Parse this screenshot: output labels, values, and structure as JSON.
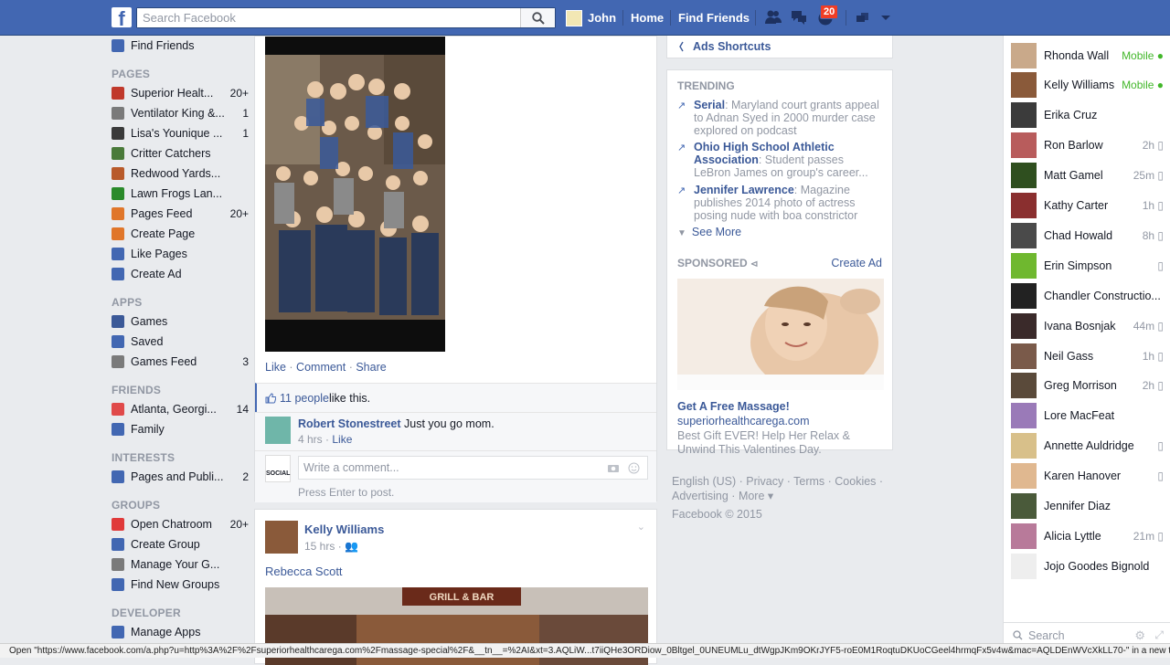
{
  "topbar": {
    "logo": "f",
    "search_placeholder": "Search Facebook",
    "user_name": "John",
    "home": "Home",
    "find_friends": "Find Friends",
    "notifications_count": "20"
  },
  "left_nav": {
    "top_items": [
      {
        "label": "Find Friends"
      }
    ],
    "pages_heading": "PAGES",
    "pages": [
      {
        "label": "Superior Healt...",
        "count": "20+"
      },
      {
        "label": "Ventilator King &...",
        "count": "1"
      },
      {
        "label": "Lisa's Younique ...",
        "count": "1"
      },
      {
        "label": "Critter Catchers",
        "count": ""
      },
      {
        "label": "Redwood Yards...",
        "count": ""
      },
      {
        "label": "Lawn Frogs Lan...",
        "count": ""
      },
      {
        "label": "Pages Feed",
        "count": "20+"
      },
      {
        "label": "Create Page",
        "count": ""
      },
      {
        "label": "Like Pages",
        "count": ""
      },
      {
        "label": "Create Ad",
        "count": ""
      }
    ],
    "apps_heading": "APPS",
    "apps": [
      {
        "label": "Games",
        "count": ""
      },
      {
        "label": "Saved",
        "count": ""
      },
      {
        "label": "Games Feed",
        "count": "3"
      }
    ],
    "friends_heading": "FRIENDS",
    "friends": [
      {
        "label": "Atlanta, Georgi...",
        "count": "14"
      },
      {
        "label": "Family",
        "count": ""
      }
    ],
    "interests_heading": "INTERESTS",
    "interests": [
      {
        "label": "Pages and Publi...",
        "count": "2"
      }
    ],
    "groups_heading": "GROUPS",
    "groups": [
      {
        "label": "Open Chatroom",
        "count": "20+"
      },
      {
        "label": "Create Group",
        "count": ""
      },
      {
        "label": "Manage Your G...",
        "count": ""
      },
      {
        "label": "Find New Groups",
        "count": ""
      }
    ],
    "developer_heading": "DEVELOPER",
    "developer": [
      {
        "label": "Manage Apps",
        "count": ""
      }
    ]
  },
  "post1": {
    "actions": {
      "like": "Like",
      "comment": "Comment",
      "share": "Share"
    },
    "likes_count": "11 people",
    "likes_suffix": " like this.",
    "comment": {
      "author": "Robert Stonestreet",
      "text": "Just you go mom.",
      "time": "4 hrs",
      "like": "Like"
    },
    "write_placeholder": "Write a comment...",
    "write_hint": "Press Enter to post.",
    "avatar_text": "SOCIAL"
  },
  "post2": {
    "author": "Kelly Williams",
    "time": "15 hrs",
    "tagged": "Rebecca Scott",
    "sign_text": "GRILL & BAR"
  },
  "right": {
    "ads_shortcuts": "Ads Shortcuts",
    "trending_heading": "TRENDING",
    "trending": [
      {
        "topic": "Serial",
        "text": ": Maryland court grants appeal to Adnan Syed in 2000 murder case explored on podcast"
      },
      {
        "topic": "Ohio High School Athletic Association",
        "text": ": Student passes LeBron James on group's career..."
      },
      {
        "topic": "Jennifer Lawrence",
        "text": ": Magazine publishes 2014 photo of actress posing nude with boa constrictor"
      }
    ],
    "see_more": "See More",
    "sponsored": "SPONSORED",
    "create_ad": "Create Ad",
    "ad": {
      "title": "Get A Free Massage!",
      "url": "superiorhealthcarega.com",
      "desc": "Best Gift EVER! Help Her Relax & Unwind This Valentines Day."
    },
    "footer": "English (US) · Privacy · Terms · Cookies · Advertising · More ▾",
    "copyright": "Facebook © 2015"
  },
  "chat": {
    "contacts": [
      {
        "name": "Rhonda Wall",
        "status": "Mobile ●",
        "mobile": true,
        "color": "#c9a98a"
      },
      {
        "name": "Kelly Williams",
        "status": "Mobile ●",
        "mobile": true,
        "color": "#8a5a3a"
      },
      {
        "name": "Erika Cruz",
        "status": "",
        "mobile": false,
        "color": "#3b3b3b"
      },
      {
        "name": "Ron Barlow",
        "status": "2h ▯",
        "mobile": false,
        "color": "#b85c5c"
      },
      {
        "name": "Matt Gamel",
        "status": "25m ▯",
        "mobile": false,
        "color": "#2f4f1f"
      },
      {
        "name": "Kathy Carter",
        "status": "1h ▯",
        "mobile": false,
        "color": "#8a2f2f"
      },
      {
        "name": "Chad Howald",
        "status": "8h ▯",
        "mobile": false,
        "color": "#4a4a4a"
      },
      {
        "name": "Erin Simpson",
        "status": "▯",
        "mobile": false,
        "color": "#6fb82f"
      },
      {
        "name": "Chandler Constructio...",
        "status": "",
        "mobile": false,
        "color": "#222222"
      },
      {
        "name": "Ivana Bosnjak",
        "status": "44m ▯",
        "mobile": false,
        "color": "#3a2a2a"
      },
      {
        "name": "Neil Gass",
        "status": "1h ▯",
        "mobile": false,
        "color": "#7a5a4a"
      },
      {
        "name": "Greg Morrison",
        "status": "2h ▯",
        "mobile": false,
        "color": "#5a4a3a"
      },
      {
        "name": "Lore MacFeat",
        "status": "",
        "mobile": false,
        "color": "#9a7ab8"
      },
      {
        "name": "Annette Auldridge",
        "status": "▯",
        "mobile": false,
        "color": "#d8c08a"
      },
      {
        "name": "Karen Hanover",
        "status": "▯",
        "mobile": false,
        "color": "#e0b890"
      },
      {
        "name": "Jennifer Diaz",
        "status": "",
        "mobile": false,
        "color": "#4a5a3a"
      },
      {
        "name": "Alicia Lyttle",
        "status": "21m ▯",
        "mobile": false,
        "color": "#b87a9a"
      },
      {
        "name": "Jojo Goodes Bignold",
        "status": "",
        "mobile": false,
        "color": "#eeeeee"
      }
    ],
    "search_placeholder": "Search"
  },
  "statusbar": "Open \"https://www.facebook.com/a.php?u=http%3A%2F%2Fsuperiorhealthcarega.com%2Fmassage-special%2F&__tn__=%2AI&xt=3.AQLiW...t7iiQHe3ORDiow_0Bltgel_0UNEUMLu_dtWgpJKm9OKrJYF5-roE0M1RoqtuDKUoCGeel4hrmqFx5v4w&mac=AQLDEnWVcXkLL70-\" in a new tab"
}
